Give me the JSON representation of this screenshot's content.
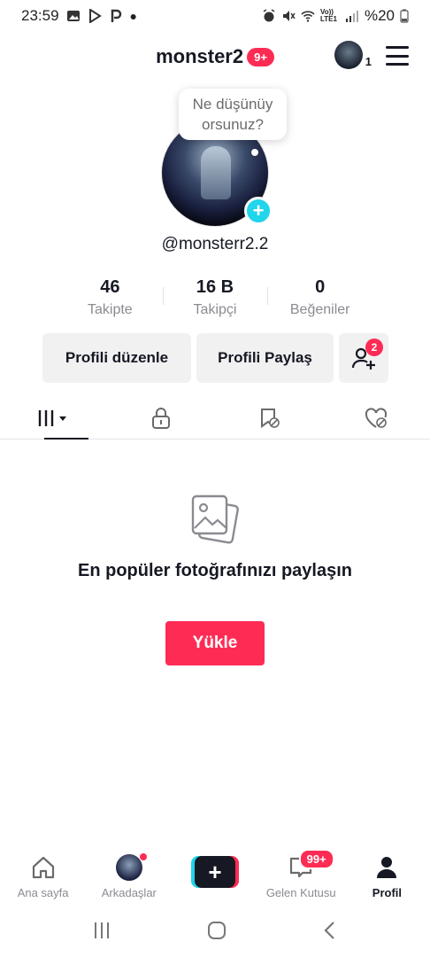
{
  "status_bar": {
    "time": "23:59",
    "battery": "%20",
    "network": "Vo)) LTE1"
  },
  "header": {
    "title": "monster2",
    "badge": "9+",
    "avatar_count": "1"
  },
  "profile": {
    "bubble_text": "Ne düşünüy orsunuz?",
    "avatar_plus": "+",
    "username": "@monsterr2.2"
  },
  "stats": [
    {
      "value": "46",
      "label": "Takipte"
    },
    {
      "value": "16 B",
      "label": "Takipçi"
    },
    {
      "value": "0",
      "label": "Beğeniler"
    }
  ],
  "actions": {
    "edit": "Profili düzenle",
    "share": "Profili Paylaş",
    "add_friends_badge": "2"
  },
  "tabs": [
    "videos-grid",
    "private",
    "reposts",
    "liked"
  ],
  "empty_state": {
    "title": "En popüler fotoğrafınızı paylaşın",
    "button": "Yükle"
  },
  "bottom_nav": {
    "items": [
      {
        "label": "Ana sayfa",
        "icon": "home-icon"
      },
      {
        "label": "Arkadaşlar",
        "icon": "friends-avatar"
      },
      {
        "label": "",
        "icon": "create-icon"
      },
      {
        "label": "Gelen Kutusu",
        "icon": "inbox-icon",
        "badge": "99+"
      },
      {
        "label": "Profil",
        "icon": "profile-icon"
      }
    ],
    "create_symbol": "+"
  },
  "colors": {
    "accent": "#fe2c55",
    "cyan": "#20d5ec",
    "text": "#161823",
    "muted": "#8a8b91"
  }
}
